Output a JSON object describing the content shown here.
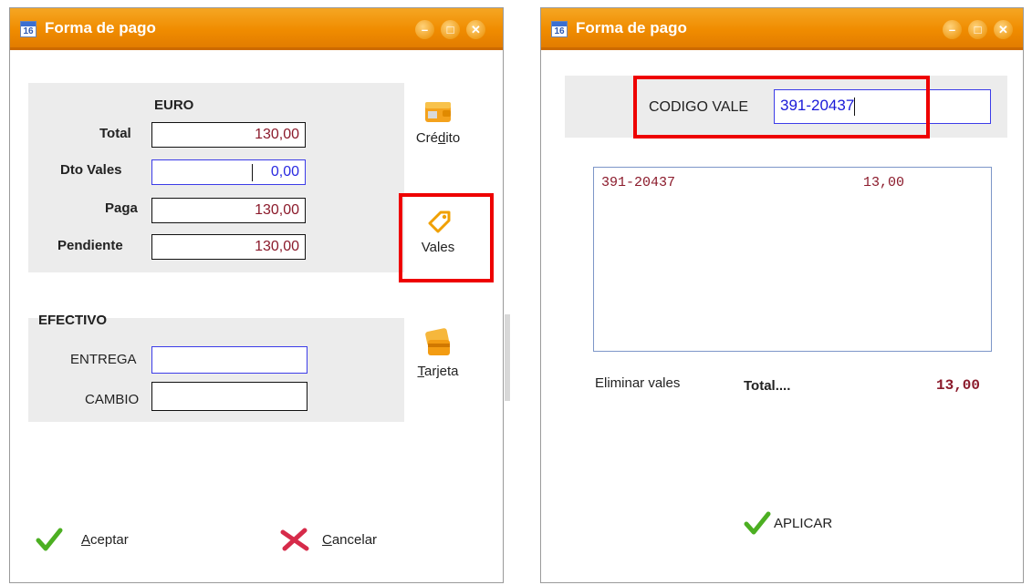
{
  "left_window": {
    "title": "Forma de pago",
    "currency_header": "EURO",
    "rows": [
      {
        "label": "Total",
        "value": "130,00"
      },
      {
        "label": "Dto Vales",
        "value": "0,00"
      },
      {
        "label": "Paga",
        "value": "130,00"
      },
      {
        "label": "Pendiente",
        "value": "130,00"
      }
    ],
    "cash_header": "EFECTIVO",
    "entrega_label": "ENTREGA",
    "entrega_value": "",
    "cambio_label": "CAMBIO",
    "cambio_value": "",
    "side_buttons": {
      "credito": {
        "pre": "Cré",
        "ul": "d",
        "post": "ito"
      },
      "vales": "Vales",
      "tarjeta": {
        "ul": "T",
        "post": "arjeta"
      }
    },
    "accept": {
      "ul": "A",
      "post": "ceptar"
    },
    "cancel": {
      "ul": "C",
      "post": "ancelar"
    }
  },
  "right_window": {
    "title": "Forma de pago",
    "codigo_label": "CODIGO VALE",
    "codigo_value": "391-20437",
    "list_items": [
      {
        "code": "391-20437",
        "amount": "13,00"
      }
    ],
    "eliminar_label": "Eliminar vales",
    "total_label": "Total....",
    "total_value": "13,00",
    "apply_label": "APLICAR"
  },
  "colors": {
    "titlebar": "#f08c00",
    "value_text": "#8b1a2b",
    "focus_border": "#3c3ce8",
    "highlight": "#ee0000"
  }
}
